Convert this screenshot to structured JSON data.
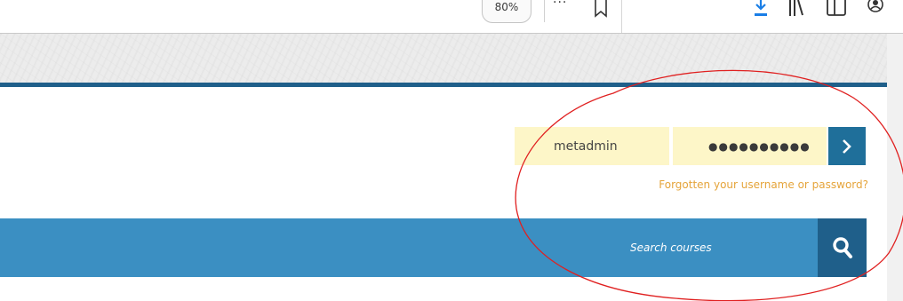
{
  "browser": {
    "zoom_label": "80%",
    "more_label": "···",
    "icons": [
      "star-icon",
      "download-icon",
      "library-icon",
      "sidebar-icon",
      "account-icon"
    ]
  },
  "login": {
    "username_value": "metadmin",
    "password_value": "●●●●●●●●●●",
    "submit_icon": "chevron-right-icon",
    "forgot_label": "Forgotten your username or password?"
  },
  "search": {
    "placeholder": "Search courses",
    "button_icon": "search-icon"
  },
  "colors": {
    "header_rule": "#1f5f8a",
    "search_bar": "#3b8fc2",
    "button_dark": "#1f6f9a",
    "input_bg": "#fdf6c8",
    "link": "#e5a43a",
    "annotation": "#e02020"
  }
}
